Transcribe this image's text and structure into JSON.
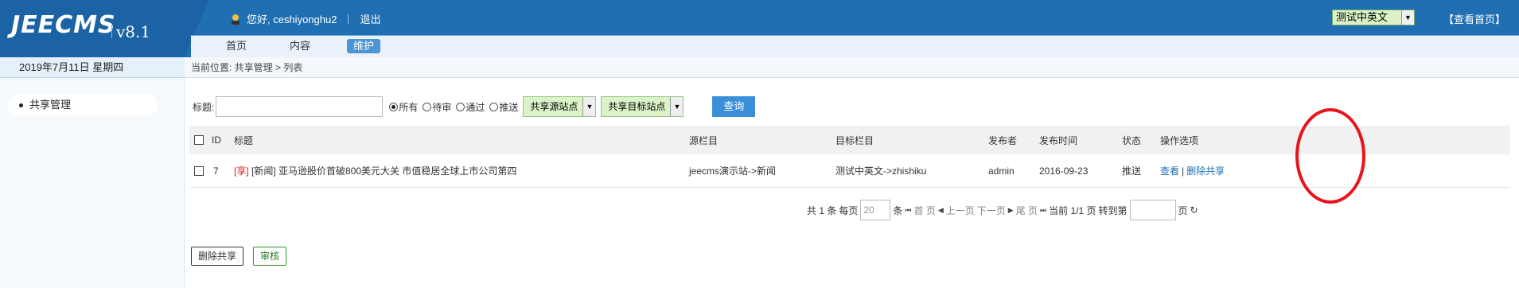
{
  "header": {
    "logo": "JEECMS",
    "version": "v8.1",
    "greeting": "您好, ceshiyonghu2",
    "logout": "退出",
    "nav": [
      "首页",
      "内容",
      "维护"
    ],
    "site_selected": "测试中英文",
    "view_home": "【查看首页】",
    "date": "2019年7月11日 星期四",
    "breadcrumb": "当前位置: 共享管理 > 列表"
  },
  "sidebar": {
    "items": [
      {
        "label": "共享管理"
      }
    ]
  },
  "search": {
    "title_label": "标题:",
    "title_value": "",
    "radios": [
      {
        "label": "所有",
        "checked": true
      },
      {
        "label": "待审",
        "checked": false
      },
      {
        "label": "通过",
        "checked": false
      },
      {
        "label": "推送",
        "checked": false
      }
    ],
    "source_site": "共享源站点",
    "target_site": "共享目标站点",
    "query_button": "查询"
  },
  "table": {
    "headers": [
      "ID",
      "标题",
      "源栏目",
      "目标栏目",
      "发布者",
      "发布时间",
      "状态",
      "操作选项"
    ],
    "rows": [
      {
        "id": "7",
        "tag1": "[享]",
        "tag2": "[新闻]",
        "title": "亚马逊股价首破800美元大关 市值稳居全球上市公司第四",
        "source_column": "jeecms演示站->新闻",
        "target_column": "测试中英文->zhishiku",
        "publisher": "admin",
        "publish_time": "2016-09-23",
        "status": "推送",
        "action_view": "查看",
        "action_sep": "|",
        "action_delete": "删除共享"
      }
    ]
  },
  "pager": {
    "total": "共 1 条",
    "per_page_label": "每页",
    "per_page_value": "20",
    "per_page_unit": "条",
    "first": "首 页",
    "prev": "上一页",
    "next": "下一页",
    "last": "尾 页",
    "current": "当前 1/1 页",
    "goto_label": "转到第",
    "goto_unit": "页"
  },
  "bottom_buttons": {
    "delete_share": "删除共享",
    "audit": "审核"
  },
  "colors": {
    "header_blue": "#1f6fb2",
    "accent_green": "#dcf3c8",
    "annotation_red": "#e8141c"
  }
}
